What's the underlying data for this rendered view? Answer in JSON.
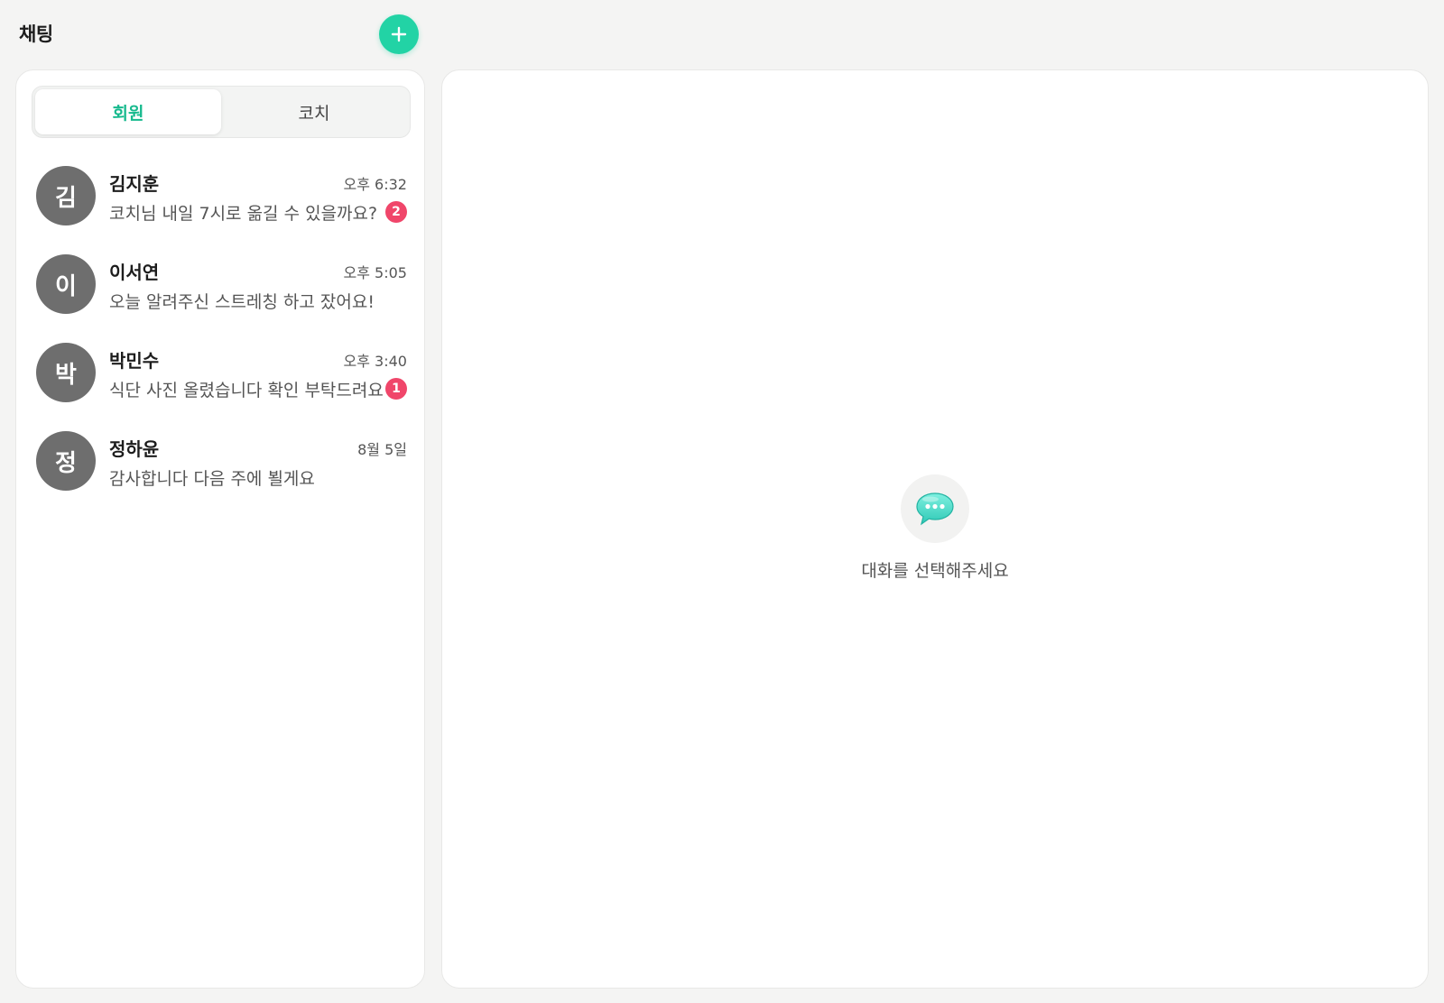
{
  "header": {
    "title": "채팅",
    "add_button_icon": "plus-icon"
  },
  "tabs": [
    {
      "label": "회원",
      "active": true
    },
    {
      "label": "코치",
      "active": false
    }
  ],
  "chats": [
    {
      "avatar": "김",
      "name": "김지훈",
      "time": "오후 6:32",
      "preview": "코치님 내일 7시로 옮길 수 있을까요?",
      "unread": "2"
    },
    {
      "avatar": "이",
      "name": "이서연",
      "time": "오후 5:05",
      "preview": "오늘 알려주신 스트레칭 하고 잤어요!",
      "unread": ""
    },
    {
      "avatar": "박",
      "name": "박민수",
      "time": "오후 3:40",
      "preview": "식단 사진 올렸습니다 확인 부탁드려요",
      "unread": "1"
    },
    {
      "avatar": "정",
      "name": "정하윤",
      "time": "8월 5일",
      "preview": "감사합니다 다음 주에 뵐게요",
      "unread": ""
    }
  ],
  "empty_state": {
    "icon": "speech-bubble-icon",
    "text": "대화를 선택해주세요"
  },
  "colors": {
    "accent": "#22d3a5",
    "active_tab_text": "#16b98d",
    "badge": "#f0466a",
    "avatar": "#6e6e6e",
    "background": "#f4f4f3"
  }
}
